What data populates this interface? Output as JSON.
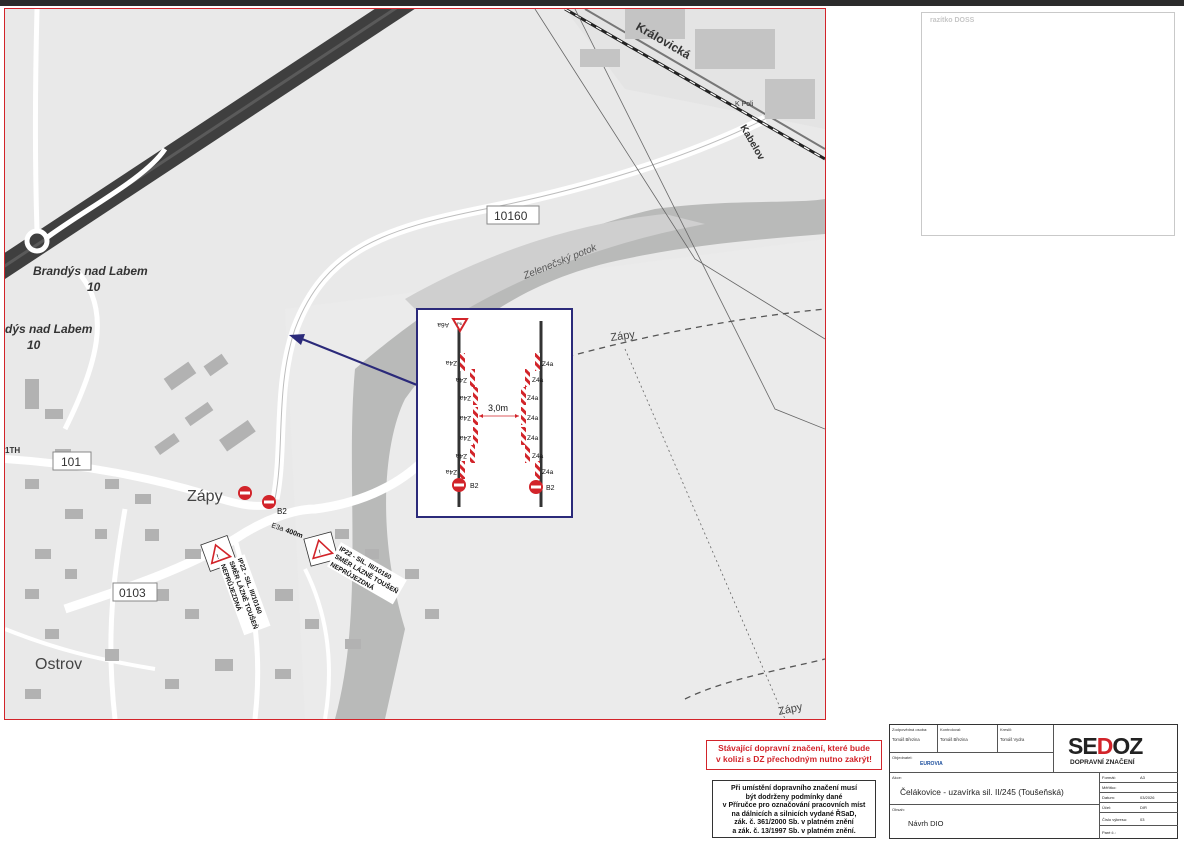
{
  "map": {
    "roads": {
      "r10160": "10160",
      "r101": "101",
      "r0103": "0103",
      "kralovicka": "Královická",
      "kabelova": "Kabelov",
      "zeleneck": "Zelenečský potok"
    },
    "places": {
      "brandys1": "Brandýs nad Labem",
      "brandys1_num": "10",
      "brandys2": "dýs nad Labem",
      "brandys2_num": "10",
      "zapy": "Zápy",
      "zapy_road": "Zápy",
      "zapy_bottom": "Zápy",
      "ostrov": "Ostrov",
      "kpoli": "K Poli",
      "h_fragment": "1TH"
    },
    "signs": {
      "b2": "B2",
      "e3a": "E3a",
      "dist400": "400m",
      "ip22a_line1": "IP22 - SIL. III/10160",
      "ip22a_line2": "SMĚR LÁZNĚ TOUŠEŇ",
      "ip22a_line3": "NEPRŮJEZDNÁ",
      "ip22b_line1": "IP22 - SIL. III/10160",
      "ip22b_line2": "SMĚR LÁZNĚ TOUŠEŇ",
      "ip22b_line3": "NEPRŮJEZDNÁ",
      "pozor": "POZOR"
    }
  },
  "inset": {
    "p6": "P6",
    "z4a": "Z4a",
    "width": "3,0m",
    "b2": "B2",
    "a6a": "A6a"
  },
  "stamp": {
    "label": "razítko DOSS"
  },
  "notes": {
    "warning_line1": "Stávající dopravní značení, které bude",
    "warning_line2": "v kolizi s DZ přechodným nutno zakrýt!",
    "rule_line1": "Při umístění dopravního značení musí",
    "rule_line2": "být dodrženy podmínky dané",
    "rule_line3": "v Příručce pro označování pracovních míst",
    "rule_line4": "na dálnicích a silnicích vydané ŘSaD,",
    "rule_line5": "zák. č. 361/2000 Sb. v platném znění",
    "rule_line6": "a zák. č. 13/1997 Sb. v platném znění."
  },
  "titleblock": {
    "zodpovedna_label": "Zodpovědná osoba:",
    "zodpovedna_value": "Tomáš Březina",
    "kontroloval_label": "Kontroloval:",
    "kontroloval_value": "Tomáš Březina",
    "kreslil_label": "Kreslil:",
    "kreslil_value": "Tomáš Vydra",
    "objednatel_label": "Objednatel:",
    "objednatel_value": "EUROVIA",
    "akce_label": "Akce:",
    "akce_value": "Čelákovice - uzavírka sil. II/245 (Toušeňská)",
    "obsah_label": "Obsah:",
    "obsah_value": "Návrh DIO",
    "format_label": "Formát:",
    "format_value": "A3",
    "meritko_label": "Měřítko:",
    "meritko_value": "",
    "datum_label": "Datum:",
    "datum_value": "03/2026",
    "ucel_label": "Účel:",
    "ucel_value": "DIR",
    "cislo_label": "Číslo výkresu:",
    "cislo_value": "03",
    "pare_label": "Paré č.:",
    "pare_value": "",
    "logo_se": "SE",
    "logo_d": "D",
    "logo_oz": "OZ",
    "logo_sub": "DOPRAVNÍ ZNAČENÍ"
  },
  "colors": {
    "frame_red": "#d2242a",
    "road_gray": "#3d3d3d",
    "arrow_blue": "#2b2a7a",
    "sign_red": "#d2242a",
    "map_bg": "#e9e9e9",
    "field_light": "#f4f4f4",
    "green_dark": "#a9aaa9"
  }
}
